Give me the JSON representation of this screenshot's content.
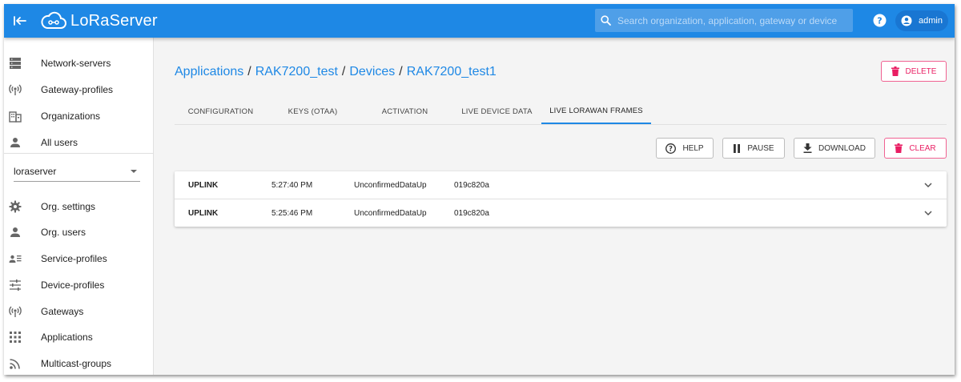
{
  "header": {
    "brand": "LoRaServer",
    "search_placeholder": "Search organization, application, gateway or device",
    "user": "admin"
  },
  "sidebar": {
    "global_items": [
      {
        "label": "Network-servers",
        "icon": "server-icon"
      },
      {
        "label": "Gateway-profiles",
        "icon": "gateway-icon"
      },
      {
        "label": "Organizations",
        "icon": "organization-icon"
      },
      {
        "label": "All users",
        "icon": "person-icon"
      }
    ],
    "org_select": "loraserver",
    "org_items": [
      {
        "label": "Org. settings",
        "icon": "gear-icon"
      },
      {
        "label": "Org. users",
        "icon": "person-icon"
      },
      {
        "label": "Service-profiles",
        "icon": "account-details-icon"
      },
      {
        "label": "Device-profiles",
        "icon": "tune-icon"
      },
      {
        "label": "Gateways",
        "icon": "gateway-icon"
      },
      {
        "label": "Applications",
        "icon": "apps-grid-icon"
      },
      {
        "label": "Multicast-groups",
        "icon": "rss-icon"
      }
    ]
  },
  "breadcrumb": {
    "applications": "Applications",
    "app_name": "RAK7200_test",
    "devices": "Devices",
    "device_name": "RAK7200_test1",
    "sep": "/"
  },
  "actions": {
    "delete": "DELETE"
  },
  "tabs": [
    {
      "label": "CONFIGURATION",
      "active": false
    },
    {
      "label": "KEYS (OTAA)",
      "active": false
    },
    {
      "label": "ACTIVATION",
      "active": false
    },
    {
      "label": "LIVE DEVICE DATA",
      "active": false
    },
    {
      "label": "LIVE LORAWAN FRAMES",
      "active": true
    }
  ],
  "toolbar": {
    "help": "HELP",
    "pause": "PAUSE",
    "download": "DOWNLOAD",
    "clear": "CLEAR"
  },
  "frames": [
    {
      "direction": "UPLINK",
      "time": "5:27:40 PM",
      "mtype": "UnconfirmedDataUp",
      "dev_addr": "019c820a"
    },
    {
      "direction": "UPLINK",
      "time": "5:25:46 PM",
      "mtype": "UnconfirmedDataUp",
      "dev_addr": "019c820a"
    }
  ],
  "colors": {
    "primary": "#1e88e5",
    "danger": "#e91e63",
    "background": "#f4f4f4"
  }
}
